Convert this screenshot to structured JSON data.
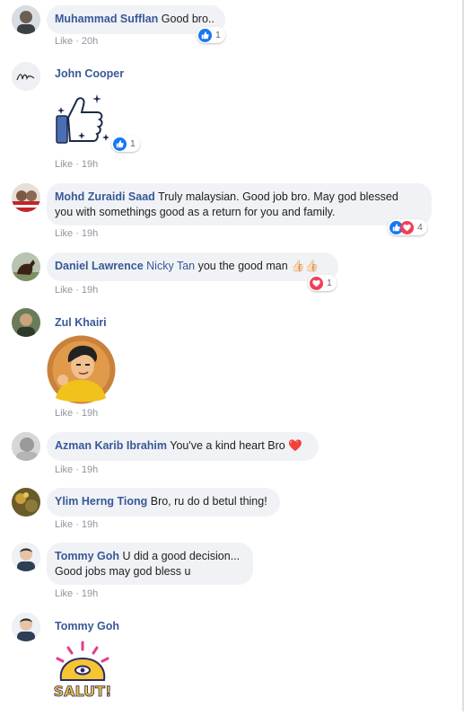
{
  "comments": [
    {
      "name": "Muhammad Sufflan",
      "text": "Good bro..",
      "meta_like": "Like",
      "meta_time": "20h",
      "reaction_count": "1",
      "reaction_icons": [
        "like-icon"
      ]
    },
    {
      "name": "John Cooper",
      "text": "",
      "meta_like": "Like",
      "meta_time": "19h",
      "reaction_count": "1",
      "reaction_icons": [
        "like-icon"
      ],
      "sticker": "thumbs-up-sticker"
    },
    {
      "name": "Mohd Zuraidi Saad",
      "text_line1": "Truly malaysian. Good job bro. May god blessed",
      "text_line2": "you with somethings good as a return for you and family.",
      "meta_like": "Like",
      "meta_time": "19h",
      "reaction_count": "4",
      "reaction_icons": [
        "like-icon",
        "love-icon"
      ]
    },
    {
      "name": "Daniel Lawrence",
      "tag": "Nicky Tan",
      "text": "you the good man",
      "emoji": "👍🏻👍🏻",
      "meta_like": "Like",
      "meta_time": "19h",
      "reaction_count": "1",
      "reaction_icons": [
        "love-icon"
      ]
    },
    {
      "name": "Zul Khairi",
      "text": "",
      "meta_like": "Like",
      "meta_time": "19h",
      "sticker": "cartoon-man-sticker"
    },
    {
      "name": "Azman Karib Ibrahim",
      "text": "You've a kind heart Bro",
      "emoji": "❤️",
      "meta_like": "Like",
      "meta_time": "19h"
    },
    {
      "name": "Ylim Herng Tiong",
      "text": "Bro, ru do d betul thing!",
      "meta_like": "Like",
      "meta_time": "19h"
    },
    {
      "name": "Tommy Goh",
      "text_line1": "U did a good decision...",
      "text_line2": "Good jobs may god bless u",
      "meta_like": "Like",
      "meta_time": "19h"
    },
    {
      "name": "Tommy Goh",
      "text": "",
      "sticker": "salut-sticker",
      "sticker_text": "SALUT!"
    }
  ],
  "colors": {
    "name": "#385898",
    "bubble": "#f0f2f5",
    "meta": "#90949c",
    "like_blue": "#1877f2",
    "love_red": "#f33e58"
  },
  "meta_separator": "·"
}
